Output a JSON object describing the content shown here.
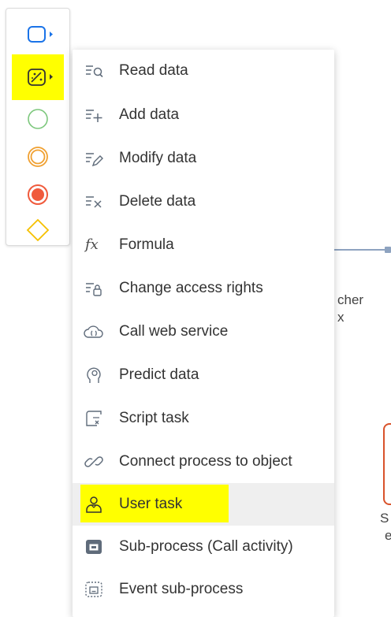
{
  "colors": {
    "accent_blue": "#1a73e8",
    "start_green": "#7cc77c",
    "intermediate_orange": "#f0a030",
    "end_red": "#f05a3c",
    "gateway_yellow": "#f5c000",
    "highlight": "#ffff00",
    "icon_gray": "#5f6b7a"
  },
  "palette": {
    "items": [
      {
        "name": "task",
        "icon": "rounded-rectangle-icon",
        "has_submenu": true
      },
      {
        "name": "magic-task",
        "icon": "magic-wand-icon",
        "has_submenu": true,
        "highlighted": true
      },
      {
        "name": "start-event",
        "icon": "green-circle-icon"
      },
      {
        "name": "intermediate-event",
        "icon": "double-orange-circle-icon"
      },
      {
        "name": "end-event",
        "icon": "red-filled-circle-icon"
      },
      {
        "name": "gateway",
        "icon": "yellow-diamond-icon"
      }
    ]
  },
  "menu": {
    "items": [
      {
        "label": "Read data",
        "icon": "read-data-icon"
      },
      {
        "label": "Add data",
        "icon": "add-data-icon"
      },
      {
        "label": "Modify data",
        "icon": "modify-data-icon"
      },
      {
        "label": "Delete data",
        "icon": "delete-data-icon"
      },
      {
        "label": "Formula",
        "icon": "formula-icon",
        "glyph": "fx"
      },
      {
        "label": "Change access rights",
        "icon": "access-rights-icon"
      },
      {
        "label": "Call web service",
        "icon": "web-service-icon"
      },
      {
        "label": "Predict data",
        "icon": "predict-data-icon"
      },
      {
        "label": "Script task",
        "icon": "script-task-icon"
      },
      {
        "label": "Connect process to object",
        "icon": "link-icon"
      },
      {
        "label": "User task",
        "icon": "user-task-icon",
        "selected": true,
        "highlighted": true
      },
      {
        "label": "Sub-process (Call activity)",
        "icon": "sub-process-icon"
      },
      {
        "label": "Event sub-process",
        "icon": "event-sub-process-icon"
      }
    ]
  },
  "canvas": {
    "fragment_1": "cher",
    "fragment_2": "x",
    "fragment_3": "S",
    "fragment_4": "e"
  }
}
